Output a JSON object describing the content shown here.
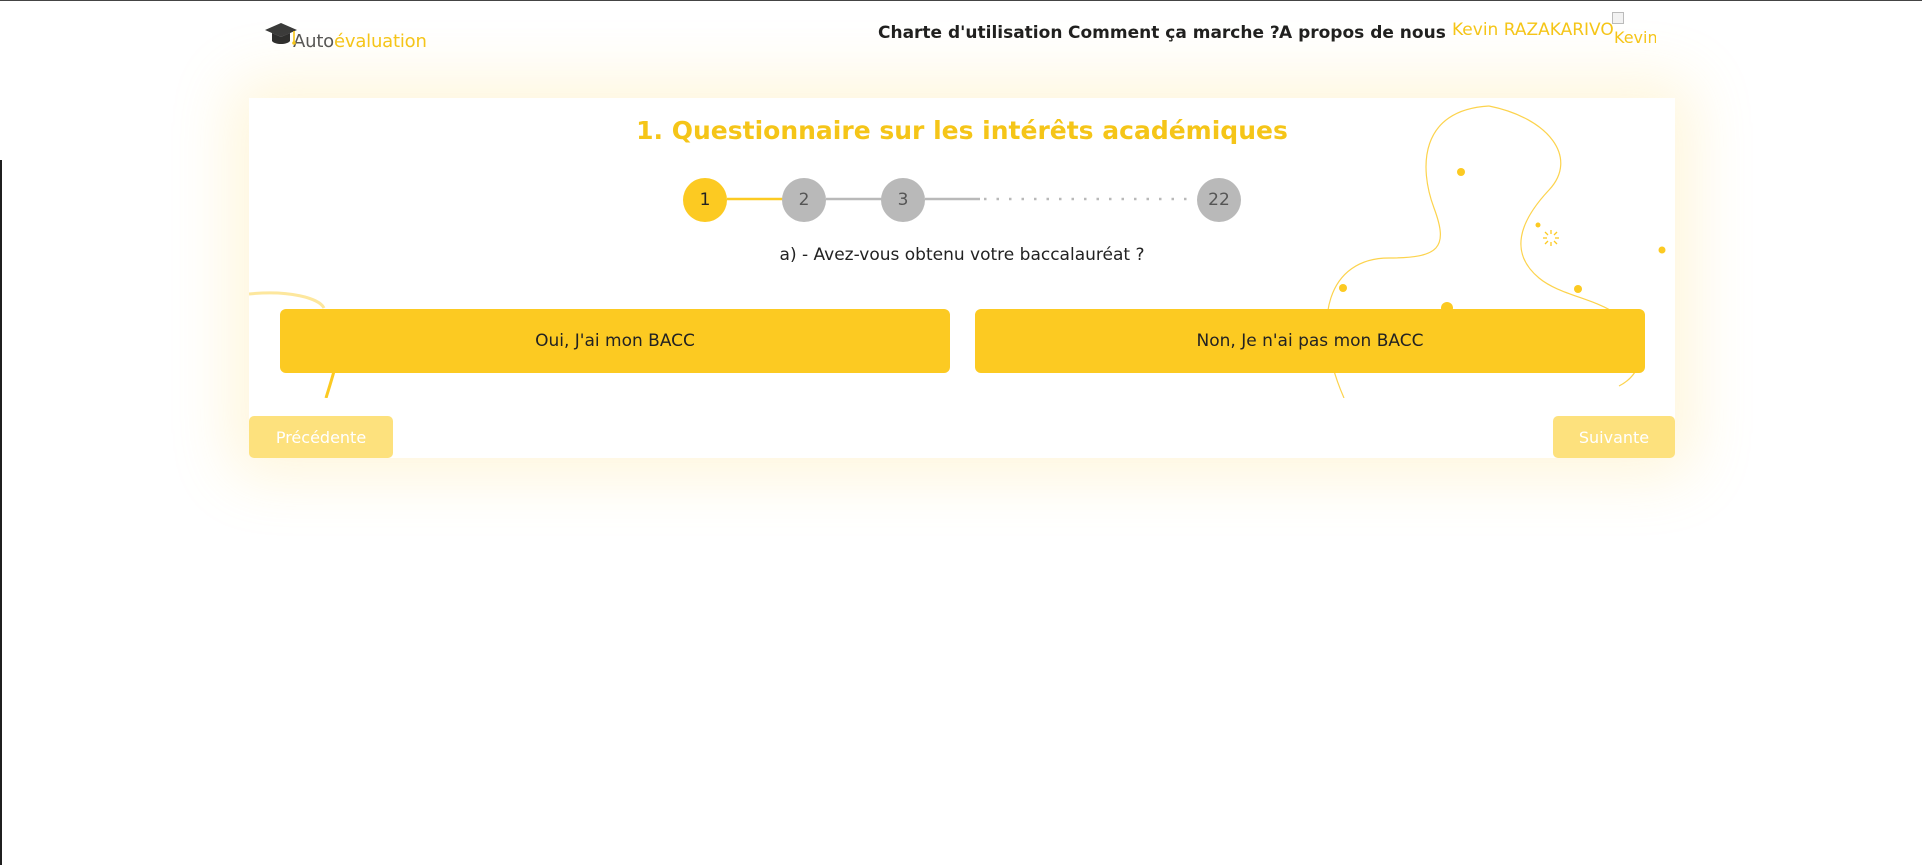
{
  "header": {
    "logo_part1": "Auto",
    "logo_part2": "évaluation",
    "nav": [
      {
        "label": "Charte d'utilisation"
      },
      {
        "label": "Comment ça marche ?"
      },
      {
        "label": "A propos de nous"
      }
    ],
    "user_name": "Kevin RAZAKARIVO",
    "avatar_alt": "Kevin"
  },
  "quiz": {
    "title": "1. Questionnaire sur les intérêts académiques",
    "steps": [
      "1",
      "2",
      "3",
      "22"
    ],
    "current_step": "1",
    "question": "a) - Avez-vous obtenu votre baccalauréat ?",
    "answers": [
      {
        "label": "Oui, J'ai mon BACC"
      },
      {
        "label": "Non, Je n'ai pas mon BACC"
      }
    ]
  },
  "navigation": {
    "previous_label": "Précédente",
    "next_label": "Suivante"
  },
  "colors": {
    "accent": "#fcca22",
    "accent_text": "#f5c518",
    "step_inactive": "#b9b9b9",
    "button_disabled": "#fde17d"
  },
  "icons": {
    "logo": "graduation-cap-icon",
    "avatar": "broken-image-icon"
  }
}
